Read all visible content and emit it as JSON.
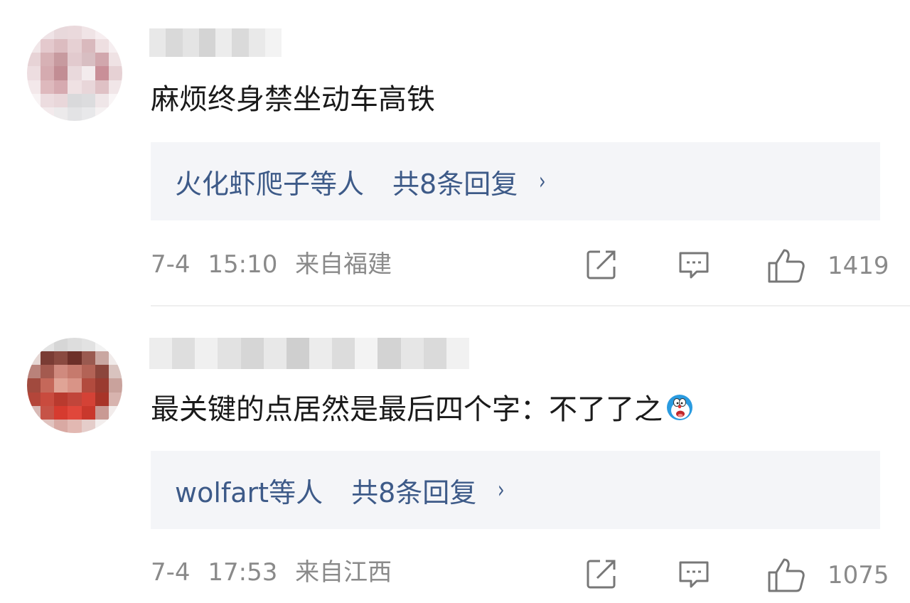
{
  "comments": [
    {
      "text": "麻烦终身禁坐动车高铁",
      "reply_users": "火化虾爬子等人",
      "reply_count": "共8条回复",
      "reply_chevron": "›",
      "date": "7-4",
      "time": "15:10",
      "location": "来自福建",
      "likes": "1419"
    },
    {
      "text": "最关键的点居然是最后四个字：不了了之",
      "emoji": "doraemon-emoji",
      "reply_users": "wolfart等人",
      "reply_count": "共8条回复",
      "reply_chevron": "›",
      "date": "7-4",
      "time": "17:53",
      "location": "来自江西",
      "likes": "1075"
    }
  ],
  "icons": {
    "share": "share-icon",
    "reply": "comment-icon",
    "like": "thumbs-up-icon"
  },
  "colors": {
    "link": "#3d5a88",
    "meta": "#8a8a8a",
    "reply_bg": "#f4f5f8",
    "text": "#1a1a1a"
  }
}
